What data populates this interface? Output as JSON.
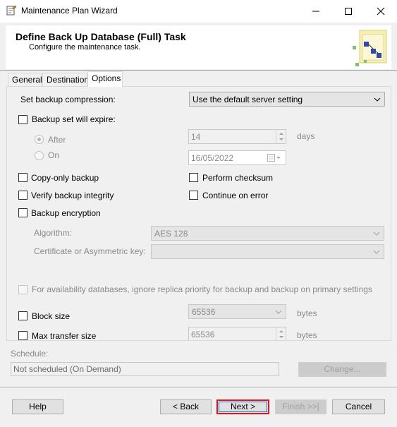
{
  "window": {
    "title": "Maintenance Plan Wizard",
    "minimize_icon": "minimize-icon",
    "maximize_icon": "maximize-icon",
    "close_icon": "close-icon"
  },
  "header": {
    "title": "Define Back Up Database (Full) Task",
    "subtitle": "Configure the maintenance task."
  },
  "tabs": [
    {
      "label": "General",
      "active": false
    },
    {
      "label": "Destination",
      "active": false
    },
    {
      "label": "Options",
      "active": true
    }
  ],
  "options": {
    "compression_label": "Set backup compression:",
    "compression_value": "Use the default server setting",
    "expire_label": "Backup set will expire:",
    "expire_checked": false,
    "after_label": "After",
    "after_selected": true,
    "after_value": "14",
    "days_label": "days",
    "on_label": "On",
    "on_date": "16/05/2022",
    "copy_only_label": "Copy-only backup",
    "perform_checksum_label": "Perform checksum",
    "verify_label": "Verify backup integrity",
    "continue_on_error_label": "Continue on error",
    "encryption_label": "Backup encryption",
    "algorithm_label": "Algorithm:",
    "algorithm_value": "AES 128",
    "certificate_label": "Certificate or Asymmetric key:",
    "certificate_value": "",
    "availability_label": "For availability databases, ignore replica priority for backup and backup on primary settings",
    "block_size_label": "Block size",
    "block_size_value": "65536",
    "block_size_unit": "bytes",
    "max_transfer_label": "Max transfer size",
    "max_transfer_value": "65536",
    "max_transfer_unit": "bytes"
  },
  "schedule": {
    "label": "Schedule:",
    "value": "Not scheduled (On Demand)",
    "change_label": "Change..."
  },
  "footer": {
    "help": "Help",
    "back": "< Back",
    "next": "Next >",
    "finish": "Finish >>|",
    "cancel": "Cancel"
  }
}
